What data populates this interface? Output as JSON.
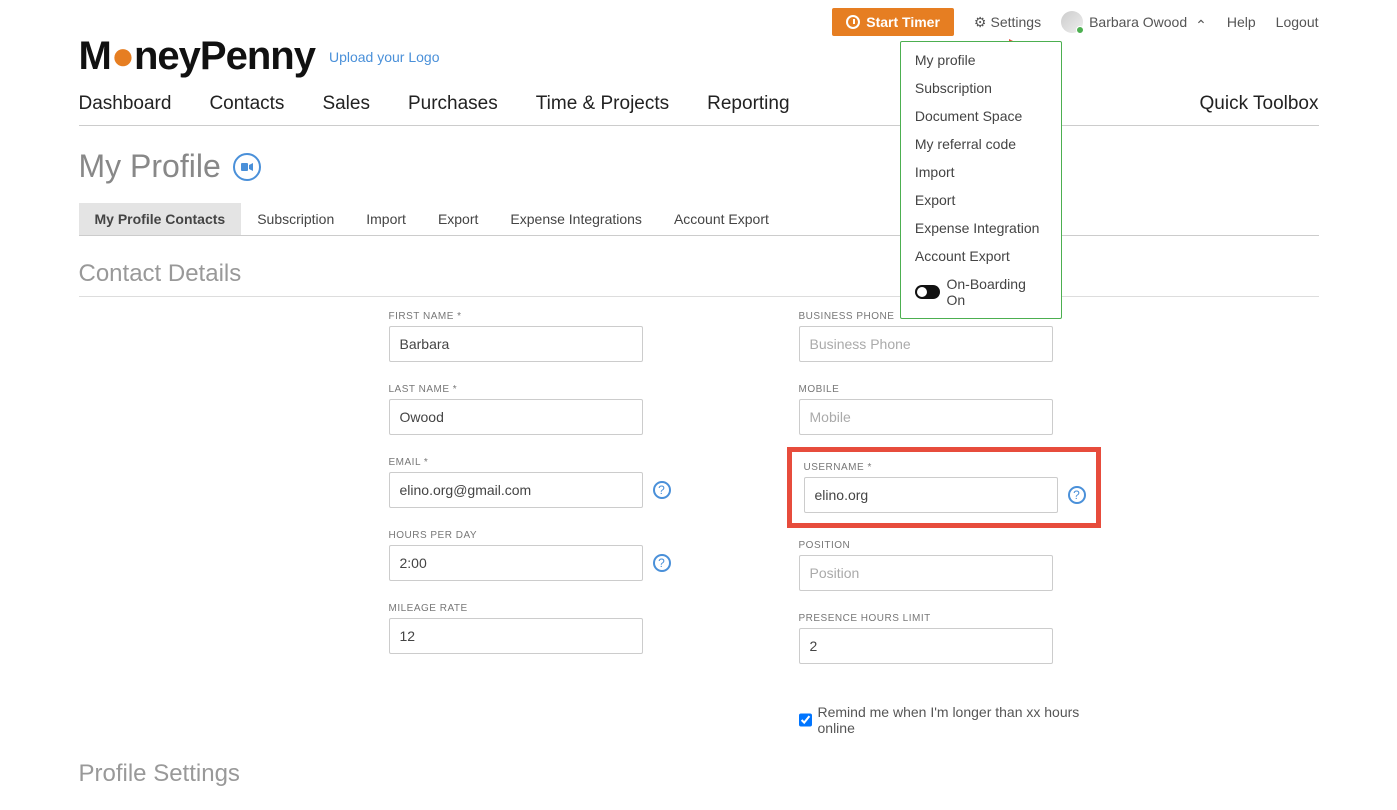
{
  "topbar": {
    "start_timer": "Start Timer",
    "settings": "Settings",
    "user_name": "Barbara Owood",
    "help": "Help",
    "logout": "Logout"
  },
  "user_menu": {
    "items": [
      "My profile",
      "Subscription",
      "Document Space",
      "My referral code",
      "Import",
      "Export",
      "Expense Integration",
      "Account Export"
    ],
    "onboarding_label": "On-Boarding On"
  },
  "logo": {
    "prefix": "M",
    "dot": "●",
    "suffix": "neyPenny",
    "upload": "Upload your Logo"
  },
  "nav": {
    "items": [
      "Dashboard",
      "Contacts",
      "Sales",
      "Purchases",
      "Time & Projects",
      "Reporting"
    ],
    "toolbox": "Quick Toolbox"
  },
  "page": {
    "title": "My Profile"
  },
  "tabs": {
    "items": [
      "My Profile Contacts",
      "Subscription",
      "Import",
      "Export",
      "Expense Integrations",
      "Account Export"
    ]
  },
  "sections": {
    "contact_details": "Contact Details",
    "profile_settings": "Profile Settings"
  },
  "fields": {
    "first_name": {
      "label": "FIRST NAME *",
      "value": "Barbara"
    },
    "last_name": {
      "label": "LAST NAME *",
      "value": "Owood"
    },
    "email": {
      "label": "EMAIL *",
      "value": "elino.org@gmail.com"
    },
    "hours_per_day": {
      "label": "HOURS PER DAY",
      "value": "2:00"
    },
    "mileage_rate": {
      "label": "MILEAGE RATE",
      "value": "12"
    },
    "business_phone": {
      "label": "BUSINESS PHONE",
      "placeholder": "Business Phone",
      "value": ""
    },
    "mobile": {
      "label": "MOBILE",
      "placeholder": "Mobile",
      "value": ""
    },
    "username": {
      "label": "USERNAME *",
      "value": "elino.org"
    },
    "position": {
      "label": "POSITION",
      "placeholder": "Position",
      "value": ""
    },
    "presence_limit": {
      "label": "PRESENCE HOURS LIMIT",
      "value": "2"
    }
  },
  "checkbox": {
    "label": "Remind me when I'm longer than xx hours online"
  }
}
